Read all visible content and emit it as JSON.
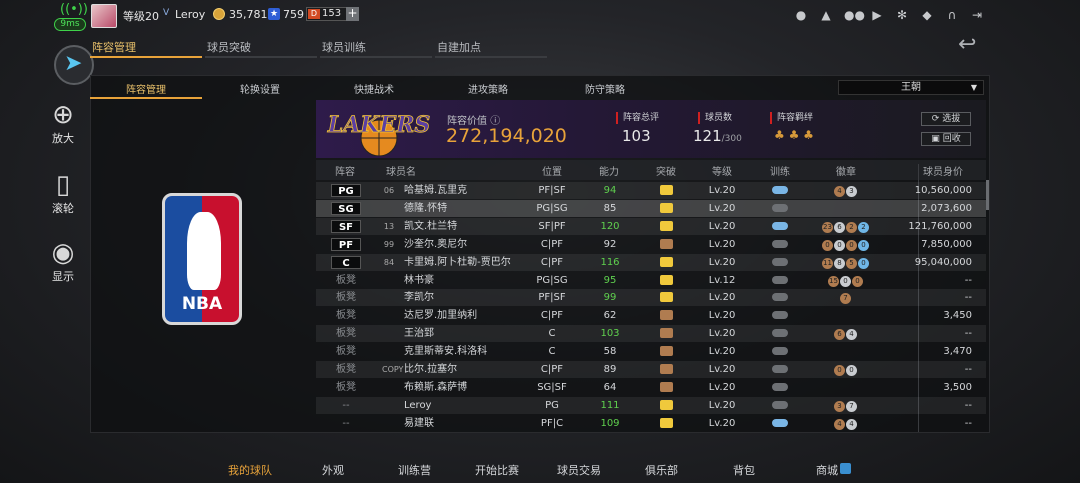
{
  "status": {
    "ping": "9ms"
  },
  "profile": {
    "level": "等级20",
    "vip": "V",
    "name": "Leroy",
    "coins": "35,781",
    "stars": "759",
    "tickets": "153"
  },
  "main_tabs": [
    "阵容管理",
    "球员突破",
    "球员训练",
    "自建加点"
  ],
  "sidebar": {
    "zoom": "放大",
    "scroll": "滚轮",
    "show": "显示"
  },
  "sub_tabs": [
    "阵容管理",
    "轮换设置",
    "快捷战术",
    "进攻策略",
    "防守策略"
  ],
  "dropdown": "王朝",
  "team": {
    "logo_text": "LAKERS",
    "value_label": "阵容价值",
    "value": "272,194,020",
    "stats": [
      {
        "label": "阵容总评",
        "value": "103",
        "sub": ""
      },
      {
        "label": "球员数",
        "value": "121",
        "sub": "/300"
      },
      {
        "label": "阵容羁绊",
        "value": "",
        "sub": ""
      }
    ],
    "buttons": [
      "选拔",
      "回收"
    ]
  },
  "nba_logo": "NBA",
  "table": {
    "headers": [
      "阵容",
      "球员名",
      "位置",
      "能力",
      "突破",
      "等级",
      "训练",
      "徽章",
      "球员身价"
    ],
    "rows": [
      {
        "lineup": "PG",
        "num": "06",
        "name": "哈基姆.瓦里克",
        "pos": "PF|SF",
        "ability": "94",
        "brk": "gold",
        "level": "Lv.20",
        "train": "blue",
        "badges": [
          "4",
          "3"
        ],
        "value": "10,560,000"
      },
      {
        "lineup": "SG",
        "num": "",
        "name": "德隆.怀特",
        "pos": "PG|SG",
        "ability": "85",
        "brk": "gold",
        "level": "Lv.20",
        "train": "gray",
        "badges": [],
        "value": "2,073,600"
      },
      {
        "lineup": "SF",
        "num": "13",
        "name": "凯文.杜兰特",
        "pos": "SF|PF",
        "ability": "120",
        "brk": "gold",
        "level": "Lv.20",
        "train": "blue",
        "badges": [
          "23",
          "6",
          "2",
          "2"
        ],
        "value": "121,760,000"
      },
      {
        "lineup": "PF",
        "num": "99",
        "name": "沙奎尔.奥尼尔",
        "pos": "C|PF",
        "ability": "92",
        "brk": "bronze",
        "level": "Lv.20",
        "train": "gray",
        "badges": [
          "0",
          "0",
          "0",
          "0"
        ],
        "value": "7,850,000"
      },
      {
        "lineup": "C",
        "num": "84",
        "name": "卡里姆.阿卜杜勒-贾巴尔",
        "pos": "C|PF",
        "ability": "116",
        "brk": "gold",
        "level": "Lv.20",
        "train": "gray",
        "badges": [
          "11",
          "8",
          "5",
          "0"
        ],
        "value": "95,040,000"
      },
      {
        "lineup": "板凳",
        "num": "",
        "name": "林书豪",
        "pos": "PG|SG",
        "ability": "95",
        "brk": "gold",
        "level": "Lv.12",
        "train": "gray",
        "badges": [
          "15",
          "0",
          "0"
        ],
        "value": "--"
      },
      {
        "lineup": "板凳",
        "num": "",
        "name": "李凯尔",
        "pos": "PF|SF",
        "ability": "99",
        "brk": "gold",
        "level": "Lv.20",
        "train": "gray",
        "badges": [
          "7"
        ],
        "value": "--"
      },
      {
        "lineup": "板凳",
        "num": "",
        "name": "达尼罗.加里纳利",
        "pos": "C|PF",
        "ability": "62",
        "brk": "bronze",
        "level": "Lv.20",
        "train": "gray",
        "badges": [],
        "value": "3,450"
      },
      {
        "lineup": "板凳",
        "num": "",
        "name": "王治郅",
        "pos": "C",
        "ability": "103",
        "brk": "bronze",
        "level": "Lv.20",
        "train": "gray",
        "badges": [
          "6",
          "4"
        ],
        "value": "--"
      },
      {
        "lineup": "板凳",
        "num": "",
        "name": "克里斯蒂安.科洛科",
        "pos": "C",
        "ability": "58",
        "brk": "bronze",
        "level": "Lv.20",
        "train": "gray",
        "badges": [],
        "value": "3,470"
      },
      {
        "lineup": "板凳",
        "num": "COPY",
        "name": "比尔.拉塞尔",
        "pos": "C|PF",
        "ability": "89",
        "brk": "bronze",
        "level": "Lv.20",
        "train": "gray",
        "badges": [
          "0",
          "0"
        ],
        "value": "--"
      },
      {
        "lineup": "板凳",
        "num": "",
        "name": "布赖斯.森萨博",
        "pos": "SG|SF",
        "ability": "64",
        "brk": "bronze",
        "level": "Lv.20",
        "train": "gray",
        "badges": [],
        "value": "3,500"
      },
      {
        "lineup": "--",
        "num": "",
        "name": "Leroy",
        "pos": "PG",
        "ability": "111",
        "brk": "gold",
        "level": "Lv.20",
        "train": "gray",
        "badges": [
          "3",
          "7"
        ],
        "value": "--"
      },
      {
        "lineup": "--",
        "num": "",
        "name": "易建联",
        "pos": "PF|C",
        "ability": "109",
        "brk": "gold",
        "level": "Lv.20",
        "train": "blue",
        "badges": [
          "4",
          "4"
        ],
        "value": "--"
      }
    ]
  },
  "bottom_nav": [
    "我的球队",
    "外观",
    "训练营",
    "开始比赛",
    "球员交易",
    "俱乐部",
    "背包",
    "商城"
  ],
  "colors": {
    "accent": "#e8a33a",
    "green": "#5fd04e",
    "gold": "#f0c93c"
  }
}
